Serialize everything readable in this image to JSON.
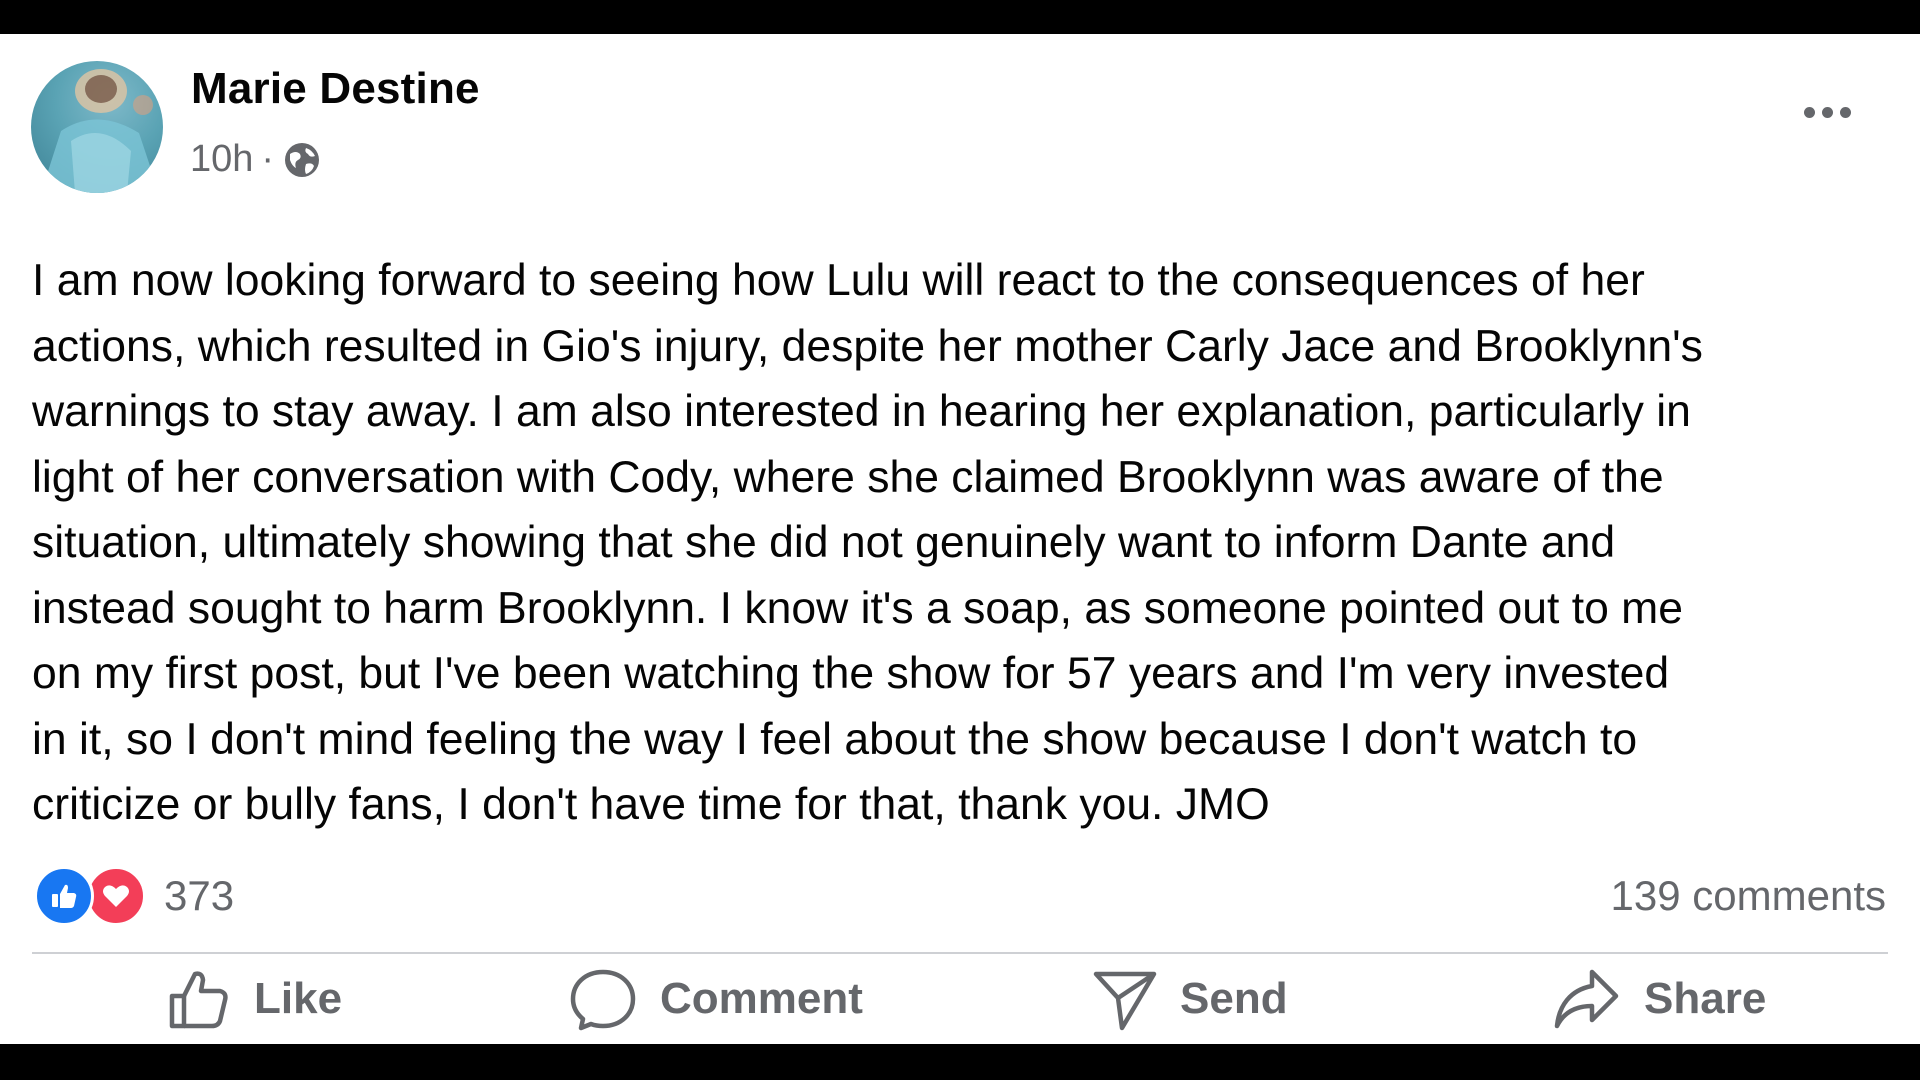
{
  "post": {
    "author": "Marie Destine",
    "time": "10h",
    "separator": "·",
    "audience_icon": "globe-icon",
    "more_icon": "more-options-icon",
    "text": "I am now looking forward to seeing how Lulu will react to the consequences of her\nactions, which resulted in Gio's injury, despite her mother Carly Jace and Brooklynn's\nwarnings to stay away. I am also interested in hearing her explanation, particularly in\nlight of her conversation with Cody, where she claimed Brooklynn was aware of the\nsituation, ultimately showing that she did not genuinely want to inform Dante and\ninstead sought to harm Brooklynn. I know it's a soap, as someone pointed out to me\non my first post, but I've been watching the show for 57 years and I'm very invested\nin it, so I don't mind feeling the way I feel about the show because I don't watch to\ncriticize or bully fans, I don't have time for that, thank you. JMO"
  },
  "stats": {
    "reactions_count": "373",
    "comments_count": "139 comments",
    "reaction_icons": [
      "like-reaction-icon",
      "love-reaction-icon"
    ]
  },
  "actions": {
    "like": "Like",
    "comment": "Comment",
    "send": "Send",
    "share": "Share"
  },
  "colors": {
    "like_blue": "#1877f2",
    "love_red": "#f33e58",
    "secondary_text": "#65676b",
    "primary_text": "#050505"
  }
}
